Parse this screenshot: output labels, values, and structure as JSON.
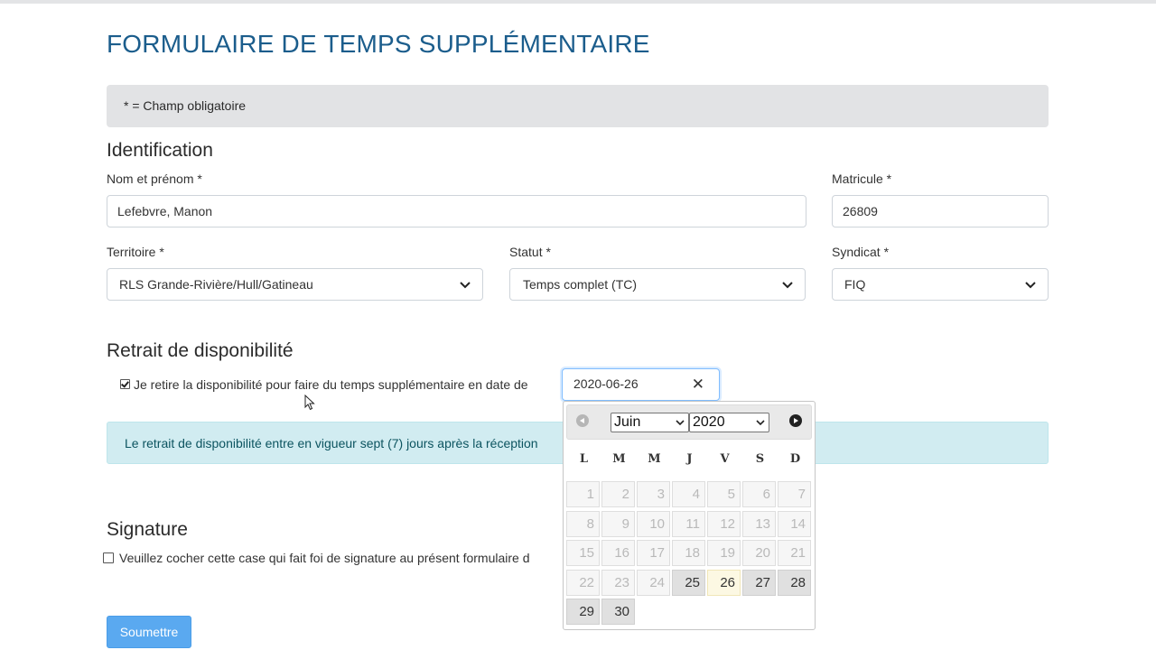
{
  "page": {
    "title": "FORMULAIRE DE TEMPS SUPPLÉMENTAIRE",
    "required_note": "* = Champ obligatoire"
  },
  "identification": {
    "heading": "Identification",
    "name_label": "Nom et prénom *",
    "name_value": "Lefebvre, Manon",
    "matricule_label": "Matricule *",
    "matricule_value": "26809",
    "territoire_label": "Territoire *",
    "territoire_value": "RLS Grande-Rivière/Hull/Gatineau",
    "statut_label": "Statut *",
    "statut_value": "Temps complet (TC)",
    "syndicat_label": "Syndicat *",
    "syndicat_value": "FIQ"
  },
  "retrait": {
    "heading": "Retrait de disponibilité",
    "checkbox_checked": true,
    "checkbox_label": "Je retire la disponibilité pour faire du temps supplémentaire en date de",
    "date_value": "2020-06-26",
    "clear_symbol": "✕",
    "info_text": "Le retrait de disponibilité entre en vigueur sept (7) jours après la réception"
  },
  "datepicker": {
    "month": "Juin",
    "year": "2020",
    "weekdays": [
      "L",
      "M",
      "M",
      "J",
      "V",
      "S",
      "D"
    ],
    "weeks": [
      [
        "1",
        "2",
        "3",
        "4",
        "5",
        "6",
        "7"
      ],
      [
        "8",
        "9",
        "10",
        "11",
        "12",
        "13",
        "14"
      ],
      [
        "15",
        "16",
        "17",
        "18",
        "19",
        "20",
        "21"
      ],
      [
        "22",
        "23",
        "24",
        "25",
        "26",
        "27",
        "28"
      ],
      [
        "29",
        "30"
      ]
    ],
    "enabled_days": [
      "25",
      "26",
      "27",
      "28",
      "29",
      "30"
    ],
    "selected_day": "26"
  },
  "signature": {
    "heading": "Signature",
    "checkbox_checked": false,
    "checkbox_label": "Veuillez cocher cette case qui fait foi de signature au présent formulaire d"
  },
  "submit": {
    "label": "Soumettre"
  },
  "colors": {
    "title": "#1b5d8c",
    "info_bg": "#d1ecf1",
    "submit_bg": "#5aa9f0",
    "selected_day_bg": "#fcf8e3"
  }
}
